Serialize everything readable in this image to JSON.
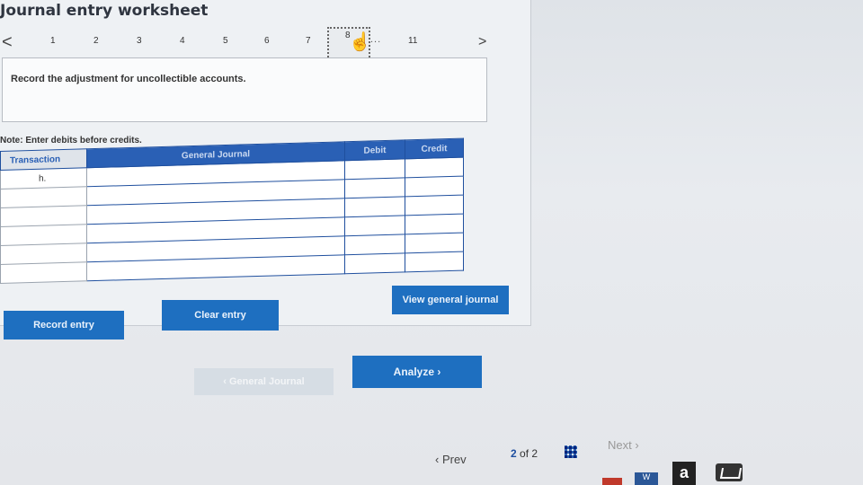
{
  "header": {
    "title": "Journal entry worksheet"
  },
  "step_nav": {
    "prev_arrow": "<",
    "next_arrow": ">",
    "steps": [
      "1",
      "2",
      "3",
      "4",
      "5",
      "6",
      "7",
      "8",
      "11"
    ],
    "active_step": "8",
    "ellipsis": "...",
    "hand_cursor": "☝"
  },
  "instruction": {
    "text": "Record the adjustment for uncollectible accounts."
  },
  "note": {
    "text": "Note: Enter debits before credits."
  },
  "journal": {
    "columns": {
      "transaction": "Transaction",
      "general_journal": "General Journal",
      "debit": "Debit",
      "credit": "Credit"
    },
    "rows": [
      {
        "transaction": "h.",
        "account": "",
        "debit": "",
        "credit": ""
      },
      {
        "transaction": "",
        "account": "",
        "debit": "",
        "credit": ""
      },
      {
        "transaction": "",
        "account": "",
        "debit": "",
        "credit": ""
      },
      {
        "transaction": "",
        "account": "",
        "debit": "",
        "credit": ""
      },
      {
        "transaction": "",
        "account": "",
        "debit": "",
        "credit": ""
      },
      {
        "transaction": "",
        "account": "",
        "debit": "",
        "credit": ""
      }
    ]
  },
  "buttons": {
    "record_entry": "Record entry",
    "clear_entry": "Clear entry",
    "view_general_journal": "View general journal",
    "general_journal_back": "‹ General Journal",
    "analyze": "Analyze ›"
  },
  "footer": {
    "prev": "‹ Prev",
    "page_current": "2",
    "page_of": "of 2",
    "next": "Next ›"
  },
  "taskbar": {
    "word_label": "W",
    "amazon_label": "a"
  },
  "colors": {
    "accent": "#1e6fc0",
    "table_header": "#2a60b5",
    "panel_bg": "#eef1f4"
  }
}
